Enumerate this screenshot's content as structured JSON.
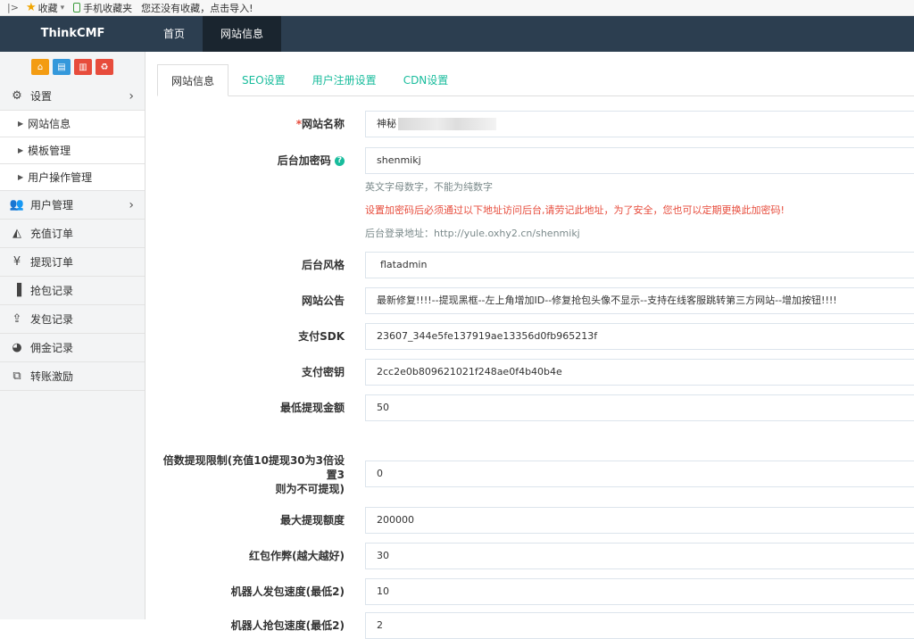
{
  "bookmark_bar": {
    "toggle": "|>",
    "favorites": "收藏",
    "mobile_favorites": "手机收藏夹",
    "import_hint": "您还没有收藏，点击导入!"
  },
  "navbar": {
    "brand": "ThinkCMF",
    "items": [
      {
        "label": "首页",
        "active": false
      },
      {
        "label": "网站信息",
        "active": true
      }
    ]
  },
  "sidebar": {
    "quick_buttons": [
      "home-icon",
      "file-icon",
      "trash-icon",
      "recycle-icon"
    ],
    "menu": [
      {
        "label": "设置",
        "icon": "gears-icon",
        "expanded": true
      },
      {
        "label": "网站信息"
      },
      {
        "label": "模板管理"
      },
      {
        "label": "用户操作管理"
      },
      {
        "label": "用户管理",
        "icon": "users-icon"
      },
      {
        "label": "充值订单",
        "icon": "area-chart-icon"
      },
      {
        "label": "提现订单",
        "icon": "yen-icon"
      },
      {
        "label": "抢包记录",
        "icon": "bar-chart-icon"
      },
      {
        "label": "发包记录",
        "icon": "upload-icon"
      },
      {
        "label": "佣金记录",
        "icon": "pie-chart-icon"
      },
      {
        "label": "转账激励",
        "icon": "clone-icon"
      }
    ]
  },
  "tabs": [
    "网站信息",
    "SEO设置",
    "用户注册设置",
    "CDN设置"
  ],
  "form": {
    "site_name": {
      "label": "网站名称",
      "required_mark": "*",
      "value": "神秘"
    },
    "admin_password": {
      "label": "后台加密码",
      "value": "shenmikj",
      "hint": "英文字母数字，不能为纯数字",
      "warning": "设置加密码后必须通过以下地址访问后台,请劳记此地址，为了安全，您也可以定期更换此加密码!",
      "login_url": "后台登录地址：http://yule.oxhy2.cn/shenmikj"
    },
    "admin_style": {
      "label": "后台风格",
      "value": "flatadmin"
    },
    "notice": {
      "label": "网站公告",
      "value": "最新修复!!!!--提现黑框--左上角增加ID--修复抢包头像不显示--支持在线客服跳转第三方网站--增加按钮!!!!"
    },
    "pay_sdk": {
      "label": "支付SDK",
      "value": "23607_344e5fe137919ae13356d0fb965213f"
    },
    "pay_key": {
      "label": "支付密钥",
      "value": "2cc2e0b809621021f248ae0f4b40b4e"
    },
    "min_withdraw": {
      "label": "最低提现金额",
      "value": "50"
    },
    "multiple_limit": {
      "label_line1": "倍数提现限制(充值10提现30为3倍设置3",
      "label_line2": "则为不可提现)",
      "value": "0"
    },
    "max_withdraw": {
      "label": "最大提现额度",
      "value": "200000"
    },
    "redpack_cheat": {
      "label": "红包作弊(越大越好)",
      "value": "30"
    },
    "robot_send_speed": {
      "label": "机器人发包速度(最低2)",
      "value": "10"
    },
    "robot_grab_speed": {
      "label": "机器人抢包速度(最低2)",
      "value": "2"
    }
  }
}
